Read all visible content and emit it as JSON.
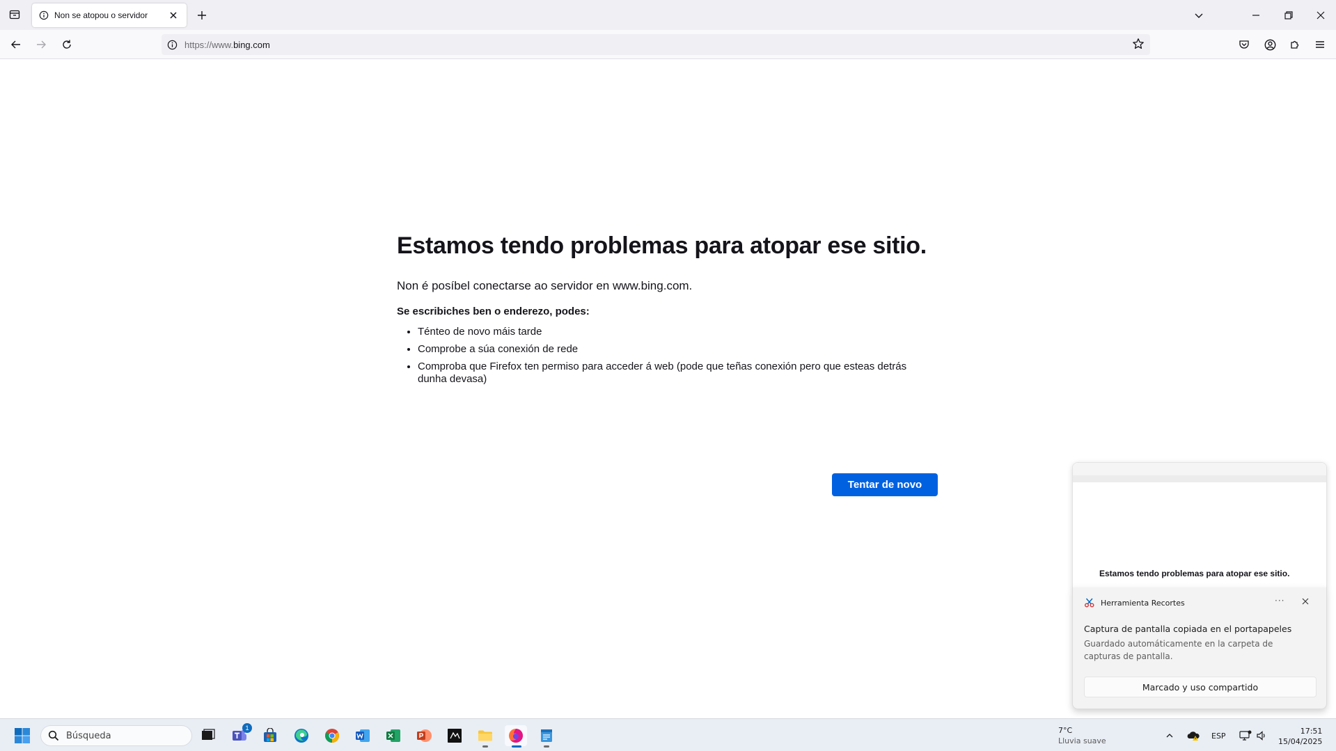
{
  "browser": {
    "tab": {
      "title": "Non se atopou o servidor"
    },
    "url": {
      "scheme": "https://www.",
      "host": "bing.com"
    }
  },
  "error_page": {
    "title": "Estamos tendo problemas para atopar ese sitio.",
    "description": "Non é posíbel conectarse ao servidor en www.bing.com.",
    "suggestions_heading": "Se escribiches ben o enderezo, podes:",
    "suggestions": [
      "Ténteo de novo máis tarde",
      "Comprobe a súa conexión de rede",
      "Comproba que Firefox ten permiso para acceder á web (pode que teñas conexión pero que esteas detrás dunha devasa)"
    ],
    "retry_label": "Tentar de novo",
    "accent_color": "#0061e0"
  },
  "notification": {
    "preview_text": "Estamos tendo problemas para atopar ese sitio.",
    "app_name": "Herramienta Recortes",
    "more_label": "···",
    "title": "Captura de pantalla copiada en el portapapeles",
    "body": "Guardado automáticamente en la carpeta de capturas de pantalla.",
    "action_label": "Marcado y uso compartido"
  },
  "taskbar": {
    "search_placeholder": "Búsqueda",
    "teams_badge": "1",
    "weather": {
      "temp": "7°C",
      "condition": "Lluvia suave"
    },
    "language": "ESP",
    "time": "17:51",
    "date": "15/04/2025",
    "apps": [
      "task-view",
      "teams",
      "microsoft-store",
      "edge",
      "chrome",
      "word",
      "excel",
      "powerpoint",
      "photo-app",
      "file-explorer",
      "firefox",
      "notepad"
    ]
  }
}
